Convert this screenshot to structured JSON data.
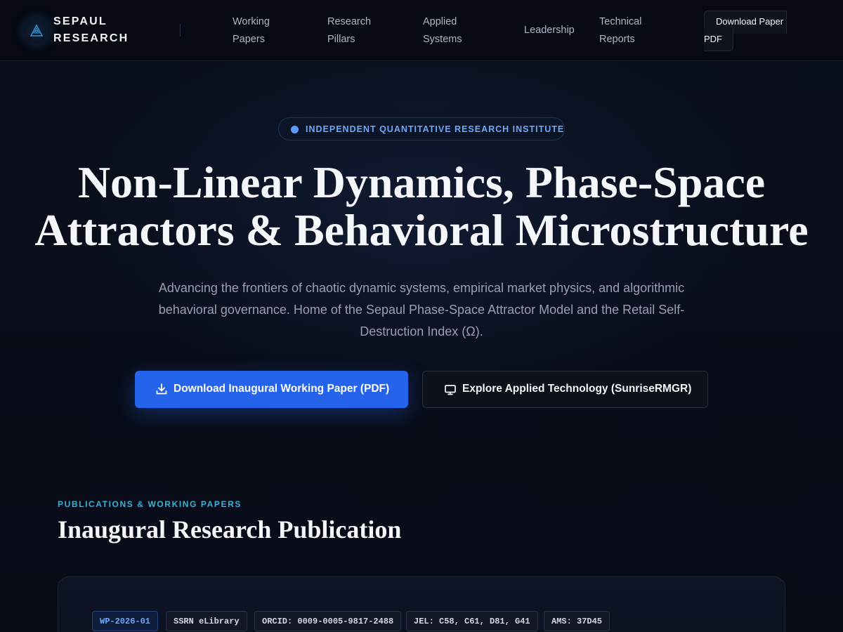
{
  "brand": {
    "name": "SEPAUL RESEARCH"
  },
  "nav": {
    "items": [
      {
        "label": "Working Papers"
      },
      {
        "label": "Research Pillars"
      },
      {
        "label": "Applied Systems"
      },
      {
        "label": "Leadership"
      },
      {
        "label": "Technical Reports"
      }
    ],
    "cta_line1": "Download Paper",
    "cta_line2": "PDF"
  },
  "hero": {
    "badge": "INDEPENDENT QUANTITATIVE RESEARCH INSTITUTE",
    "title": "Non-Linear Dynamics, Phase-Space Attractors & Behavioral Microstructure",
    "subtitle": "Advancing the frontiers of chaotic dynamic systems, empirical market physics, and algorithmic behavioral governance. Home of the Sepaul Phase-Space Attractor Model and the Retail Self-Destruction Index (Ω).",
    "primary_button": "Download Inaugural Working Paper (PDF)",
    "secondary_button": "Explore Applied Technology (SunriseRMGR)"
  },
  "publications": {
    "eyebrow": "PUBLICATIONS & WORKING PAPERS",
    "title": "Inaugural Research Publication",
    "tags": [
      "WP-2026-01",
      "SSRN eLibrary",
      "ORCID: 0009-0005-9817-2488",
      "JEL: C58, C61, D81, G41",
      "AMS: 37D45"
    ]
  },
  "colors": {
    "background": "#080c17",
    "accent": "#2563eb",
    "badge_text": "#6ea8f7",
    "eyebrow": "#38b2d8"
  },
  "icons": [
    "logo-triangle-icon",
    "download-icon",
    "monitor-icon"
  ]
}
